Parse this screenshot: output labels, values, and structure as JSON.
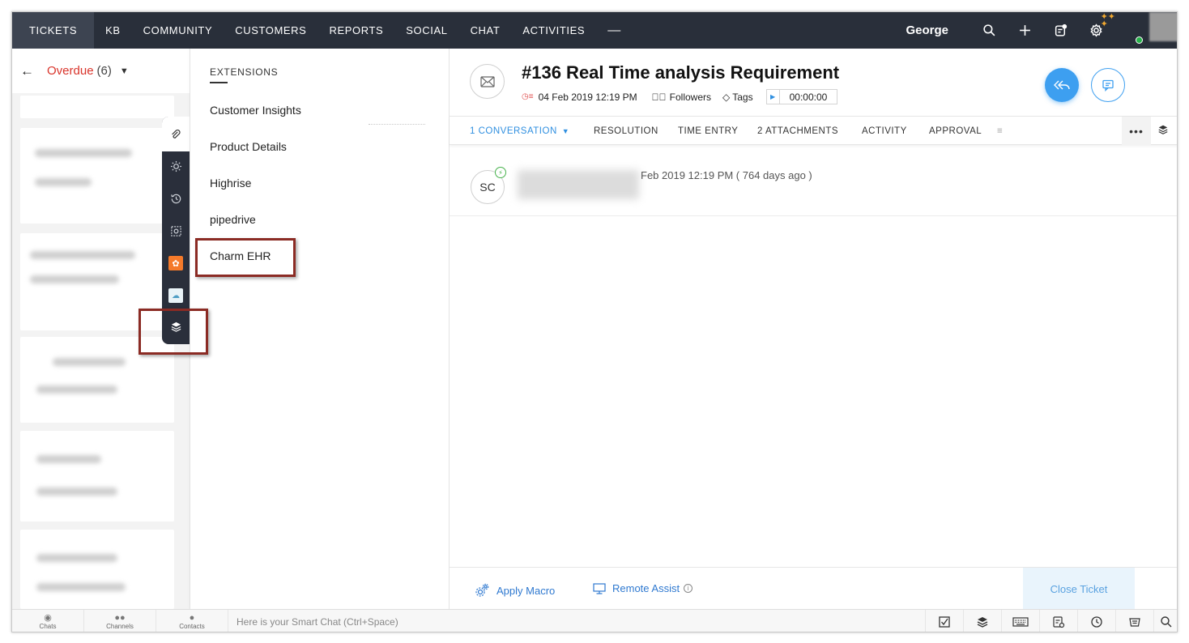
{
  "nav": {
    "items": [
      "TICKETS",
      "KB",
      "COMMUNITY",
      "CUSTOMERS",
      "REPORTS",
      "SOCIAL",
      "CHAT",
      "ACTIVITIES"
    ],
    "active": "TICKETS",
    "user": "George",
    "icons": [
      "search-icon",
      "plus-icon",
      "notes-icon",
      "gear-icon"
    ]
  },
  "left_panel": {
    "view_title": "Overdue",
    "count": "(6)"
  },
  "extensions": {
    "heading": "EXTENSIONS",
    "items": [
      "Customer Insights",
      "Product Details",
      "Highrise",
      "pipedrive",
      "Charm EHR"
    ]
  },
  "ticket": {
    "title": "#136  Real Time analysis Requirement",
    "due": "04 Feb 2019 12:19 PM",
    "followers_label": "Followers",
    "tags_label": "Tags",
    "timer": "00:00:00"
  },
  "tabs": [
    "1 CONVERSATION",
    "RESOLUTION",
    "TIME ENTRY",
    "2 ATTACHMENTS",
    "ACTIVITY",
    "APPROVAL"
  ],
  "conversation": {
    "avatar_initials": "SC",
    "time": "Feb 2019 12:19 PM ( 764 days ago )"
  },
  "actions": {
    "apply_macro": "Apply Macro",
    "remote_assist": "Remote Assist",
    "close_ticket": "Close Ticket"
  },
  "footer": {
    "items": [
      "Chats",
      "Channels",
      "Contacts"
    ],
    "smart_chat_placeholder": "Here is your Smart Chat (Ctrl+Space)"
  },
  "colors": {
    "nav_bg": "#292f3a",
    "accent_blue": "#3d9ff0",
    "overdue_red": "#d9342b",
    "highlight_box": "#8b2b24"
  }
}
